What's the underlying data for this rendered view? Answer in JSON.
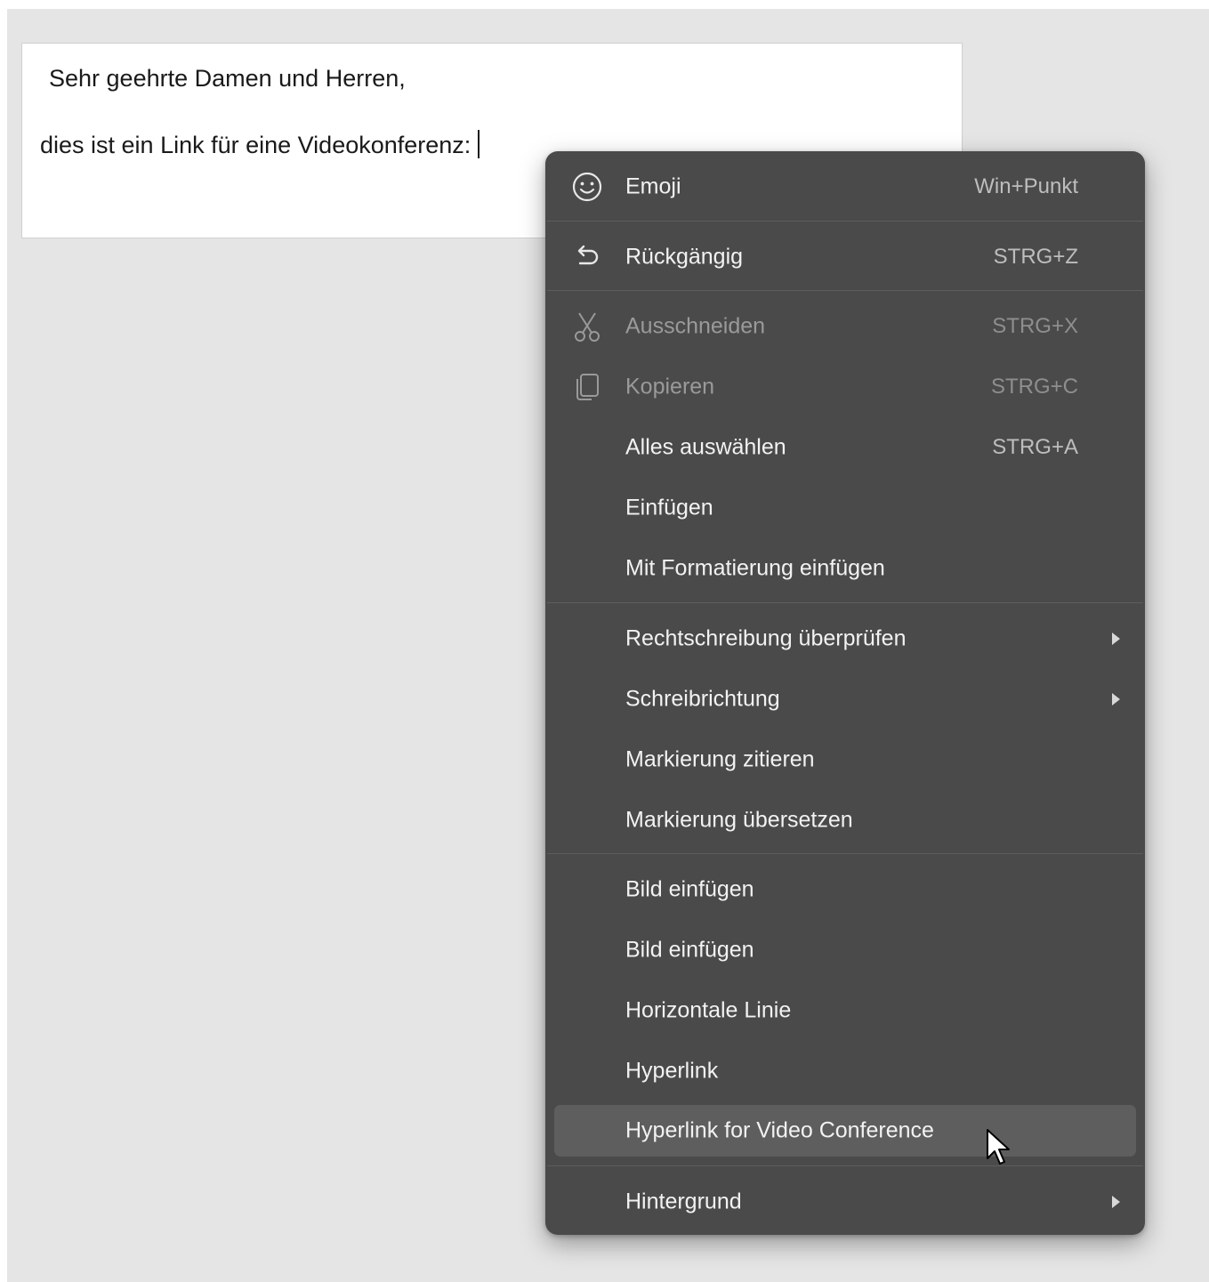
{
  "editor": {
    "line1": "Sehr geehrte Damen und Herren,",
    "line2": "dies ist ein Link für eine Videokonferenz:"
  },
  "menu": {
    "items": [
      {
        "label": "Emoji",
        "shortcut": "Win+Punkt",
        "icon": "emoji-icon"
      },
      {
        "label": "Rückgängig",
        "shortcut": "STRG+Z",
        "icon": "undo-icon"
      },
      {
        "label": "Ausschneiden",
        "shortcut": "STRG+X",
        "icon": "scissors-icon",
        "disabled": true
      },
      {
        "label": "Kopieren",
        "shortcut": "STRG+C",
        "icon": "copy-icon",
        "disabled": true
      },
      {
        "label": "Alles auswählen",
        "shortcut": "STRG+A"
      },
      {
        "label": "Einfügen"
      },
      {
        "label": "Mit Formatierung einfügen"
      },
      {
        "label": "Rechtschreibung überprüfen",
        "submenu": true
      },
      {
        "label": "Schreibrichtung",
        "submenu": true
      },
      {
        "label": "Markierung zitieren"
      },
      {
        "label": "Markierung übersetzen"
      },
      {
        "label": "Bild einfügen"
      },
      {
        "label": "Bild einfügen"
      },
      {
        "label": "Horizontale Linie"
      },
      {
        "label": "Hyperlink"
      },
      {
        "label": "Hyperlink for Video Conference",
        "highlighted": true
      },
      {
        "label": "Hintergrund",
        "submenu": true
      }
    ]
  },
  "colors": {
    "menu_bg": "#4a4a4a",
    "highlight_bg": "#5e5e5e",
    "text": "#f2f2f2",
    "disabled_text": "#9a9a9a"
  }
}
